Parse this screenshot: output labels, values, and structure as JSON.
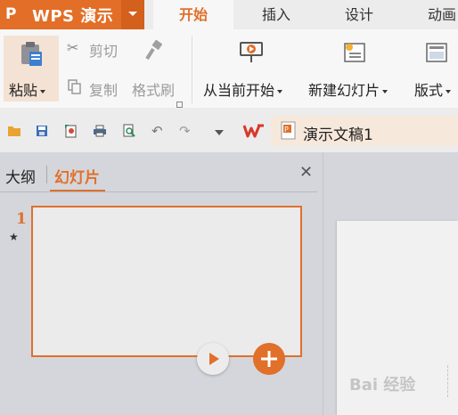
{
  "app": {
    "logo": "P",
    "title": "WPS 演示",
    "accent": "#e0702a"
  },
  "tabs": [
    {
      "label": "开始",
      "active": true
    },
    {
      "label": "插入"
    },
    {
      "label": "设计"
    },
    {
      "label": "动画"
    }
  ],
  "ribbon": {
    "paste": "粘贴",
    "cut": "剪切",
    "copy": "复制",
    "format_painter": "格式刷",
    "from_current": "从当前开始",
    "new_slide": "新建幻灯片",
    "layout": "版式"
  },
  "document": {
    "name": "演示文稿1"
  },
  "panel": {
    "outline_tab": "大纲",
    "slides_tab": "幻灯片",
    "slide_number": "1",
    "star": "★"
  },
  "watermark": "Bai 经验"
}
